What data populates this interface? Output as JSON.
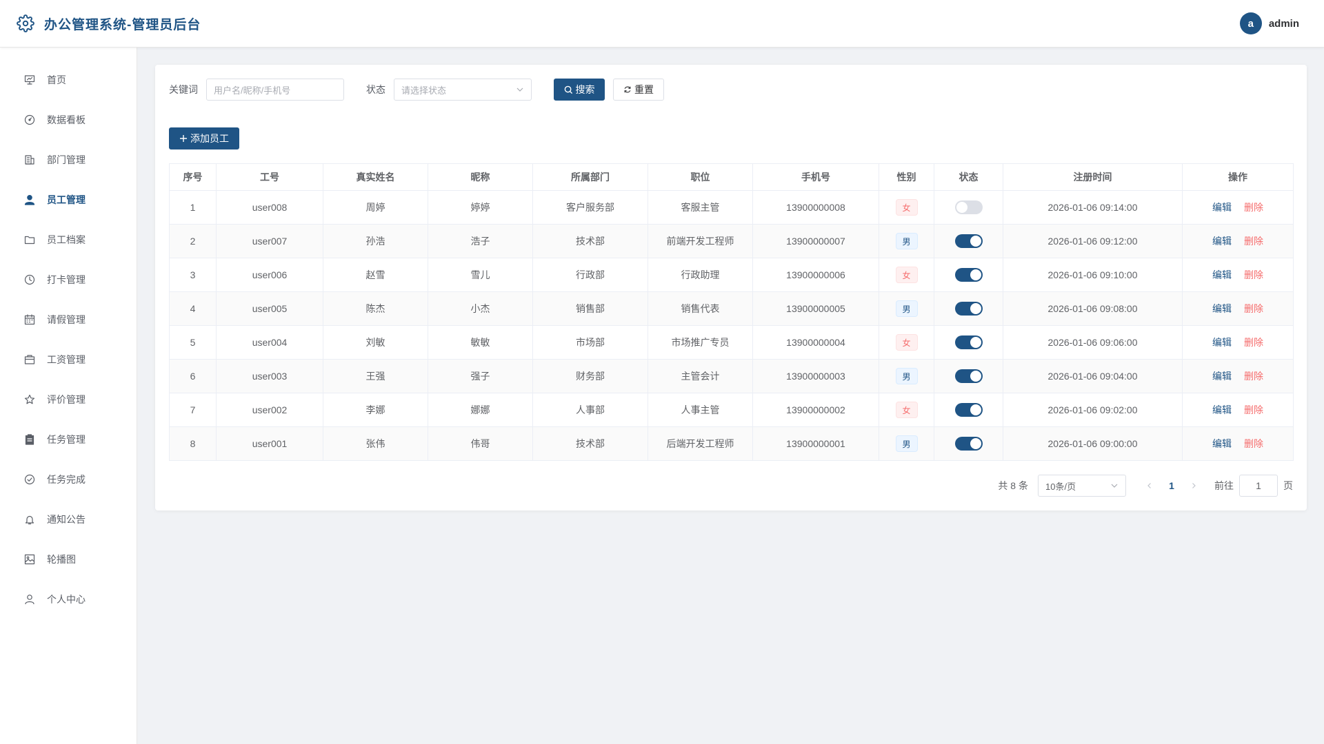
{
  "header": {
    "title": "办公管理系统-管理员后台",
    "avatar_letter": "a",
    "username": "admin"
  },
  "sidebar": {
    "items": [
      {
        "label": "首页",
        "icon": "presentation-icon",
        "active": false
      },
      {
        "label": "数据看板",
        "icon": "dashboard-gauge-icon",
        "active": false
      },
      {
        "label": "部门管理",
        "icon": "building-icon",
        "active": false
      },
      {
        "label": "员工管理",
        "icon": "user-icon",
        "active": true
      },
      {
        "label": "员工档案",
        "icon": "folder-icon",
        "active": false
      },
      {
        "label": "打卡管理",
        "icon": "clock-icon",
        "active": false
      },
      {
        "label": "请假管理",
        "icon": "calendar-icon",
        "active": false
      },
      {
        "label": "工资管理",
        "icon": "wallet-folder-icon",
        "active": false
      },
      {
        "label": "评价管理",
        "icon": "star-icon",
        "active": false
      },
      {
        "label": "任务管理",
        "icon": "clipboard-icon",
        "active": false
      },
      {
        "label": "任务完成",
        "icon": "check-circle-icon",
        "active": false
      },
      {
        "label": "通知公告",
        "icon": "bell-icon",
        "active": false
      },
      {
        "label": "轮播图",
        "icon": "picture-icon",
        "active": false
      },
      {
        "label": "个人中心",
        "icon": "user-outline-icon",
        "active": false
      }
    ]
  },
  "filters": {
    "keyword_label": "关键词",
    "keyword_placeholder": "用户名/昵称/手机号",
    "status_label": "状态",
    "status_placeholder": "请选择状态",
    "search_label": "搜索",
    "reset_label": "重置"
  },
  "toolbar": {
    "add_label": "添加员工"
  },
  "table": {
    "columns": [
      "序号",
      "工号",
      "真实姓名",
      "昵称",
      "所属部门",
      "职位",
      "手机号",
      "性别",
      "状态",
      "注册时间",
      "操作"
    ],
    "edit_label": "编辑",
    "delete_label": "删除",
    "rows": [
      {
        "no": "1",
        "id": "user008",
        "name": "周婷",
        "nickname": "婷婷",
        "dept": "客户服务部",
        "position": "客服主管",
        "phone": "13900000008",
        "gender": "女",
        "enabled": false,
        "registered": "2026-01-06 09:14:00"
      },
      {
        "no": "2",
        "id": "user007",
        "name": "孙浩",
        "nickname": "浩子",
        "dept": "技术部",
        "position": "前端开发工程师",
        "phone": "13900000007",
        "gender": "男",
        "enabled": true,
        "registered": "2026-01-06 09:12:00"
      },
      {
        "no": "3",
        "id": "user006",
        "name": "赵雪",
        "nickname": "雪儿",
        "dept": "行政部",
        "position": "行政助理",
        "phone": "13900000006",
        "gender": "女",
        "enabled": true,
        "registered": "2026-01-06 09:10:00"
      },
      {
        "no": "4",
        "id": "user005",
        "name": "陈杰",
        "nickname": "小杰",
        "dept": "销售部",
        "position": "销售代表",
        "phone": "13900000005",
        "gender": "男",
        "enabled": true,
        "registered": "2026-01-06 09:08:00"
      },
      {
        "no": "5",
        "id": "user004",
        "name": "刘敏",
        "nickname": "敏敏",
        "dept": "市场部",
        "position": "市场推广专员",
        "phone": "13900000004",
        "gender": "女",
        "enabled": true,
        "registered": "2026-01-06 09:06:00"
      },
      {
        "no": "6",
        "id": "user003",
        "name": "王强",
        "nickname": "强子",
        "dept": "财务部",
        "position": "主管会计",
        "phone": "13900000003",
        "gender": "男",
        "enabled": true,
        "registered": "2026-01-06 09:04:00"
      },
      {
        "no": "7",
        "id": "user002",
        "name": "李娜",
        "nickname": "娜娜",
        "dept": "人事部",
        "position": "人事主管",
        "phone": "13900000002",
        "gender": "女",
        "enabled": true,
        "registered": "2026-01-06 09:02:00"
      },
      {
        "no": "8",
        "id": "user001",
        "name": "张伟",
        "nickname": "伟哥",
        "dept": "技术部",
        "position": "后端开发工程师",
        "phone": "13900000001",
        "gender": "男",
        "enabled": true,
        "registered": "2026-01-06 09:00:00"
      }
    ]
  },
  "pagination": {
    "total_text": "共 8 条",
    "page_size": "10条/页",
    "current_page": "1",
    "goto_label": "前往",
    "goto_value": "1",
    "page_suffix": "页"
  },
  "colors": {
    "primary": "#1f5485",
    "danger": "#f56c6c",
    "background": "#f0f2f5"
  }
}
